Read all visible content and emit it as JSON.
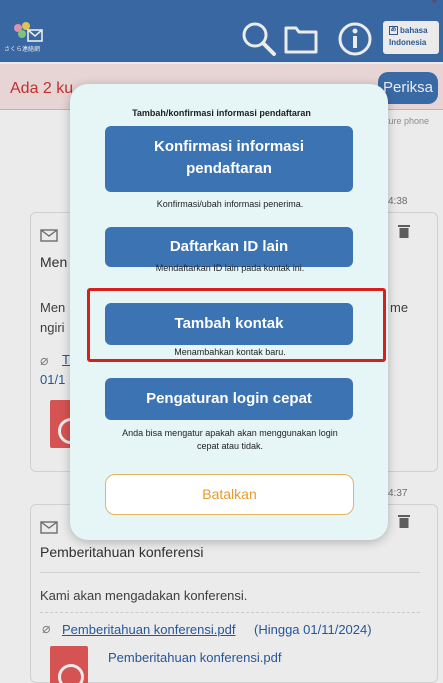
{
  "header": {
    "logo_text": "さくら連絡網",
    "language_button": {
      "line1": "bahasa",
      "line2": "Indonesia",
      "glyph": "あ"
    },
    "corner_mark": "\""
  },
  "notice": {
    "text": "Ada 2 ku",
    "button_label": "Periksa",
    "sub_text": "ture phone"
  },
  "background": {
    "times": [
      "4:38",
      "4:37"
    ],
    "card1": {
      "title": "Men",
      "body_line1": "Men",
      "body_line1_end": "me",
      "body_line2": "ngiri",
      "link_partial": "T",
      "date_partial": "01/1"
    },
    "card2": {
      "title": "Pemberitahuan konferensi",
      "body": "Kami akan mengadakan konferensi.",
      "link": "Pemberitahuan konferensi.pdf",
      "link_suffix": "(Hingga 01/11/2024)",
      "pdf_name": "Pemberitahuan konferensi.pdf"
    }
  },
  "modal": {
    "title": "Tambah/konfirmasi informasi pendaftaran",
    "buttons": [
      {
        "line1": "Konfirmasi informasi",
        "line2": "pendaftaran",
        "desc": "Konfirmasi/ubah informasi penerima."
      },
      {
        "label": "Daftarkan ID lain",
        "desc": "Mendaftarkan ID lain pada kontak ini."
      },
      {
        "label": "Tambah kontak",
        "desc": "Menambahkan kontak baru."
      },
      {
        "label": "Pengaturan login cepat",
        "desc_line1": "Anda bisa mengatur apakah akan menggunakan login",
        "desc_line2": "cepat atau tidak."
      }
    ],
    "cancel_label": "Batalkan"
  },
  "colors": {
    "header_blue": "#3d70b0",
    "button_blue": "#3c73b3",
    "modal_bg": "#e6f6f7",
    "highlight_red": "#d91e1e",
    "cancel_orange": "#e89a2c"
  },
  "icons": [
    "logo-icon",
    "search-icon",
    "folder-icon",
    "info-icon",
    "language-icon",
    "envelope-icon",
    "trash-icon",
    "clip-icon",
    "pdf-icon"
  ]
}
